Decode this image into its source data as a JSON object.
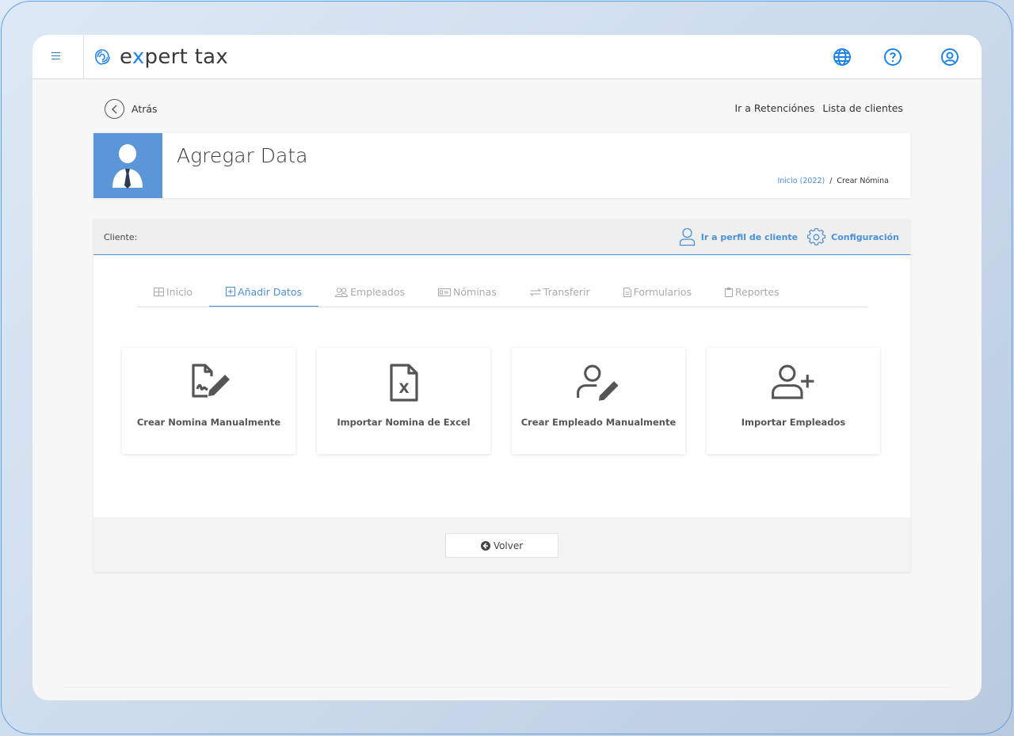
{
  "brand": {
    "name_prefix": "e",
    "name_x": "x",
    "name_suffix": "pert tax",
    "accent": "#1f84e6"
  },
  "topbar": {
    "icons": [
      "globe-icon",
      "help-icon",
      "user-circle-icon"
    ]
  },
  "nav": {
    "back_label": "Atrás",
    "links": [
      "Ir a Retenciónes",
      "Lista de clientes"
    ]
  },
  "header": {
    "title": "Agregar Data",
    "breadcrumb": {
      "home": "Inicio (2022)",
      "separator": "/",
      "current": "Crear Nómina"
    }
  },
  "panel": {
    "client_label": "Cliente:",
    "actions": {
      "profile": "Ir a perfil de cliente",
      "settings": "Configuración"
    },
    "tabs": [
      {
        "label": "Inicio",
        "icon": "grid-icon",
        "active": false
      },
      {
        "label": "Añadir Datos",
        "icon": "plus-square-icon",
        "active": true
      },
      {
        "label": "Empleados",
        "icon": "users-icon",
        "active": false
      },
      {
        "label": "Nóminas",
        "icon": "payroll-icon",
        "active": false
      },
      {
        "label": "Transferir",
        "icon": "transfer-icon",
        "active": false
      },
      {
        "label": "Formularios",
        "icon": "document-icon",
        "active": false
      },
      {
        "label": "Reportes",
        "icon": "clipboard-icon",
        "active": false
      }
    ],
    "cards": [
      {
        "label": "Crear Nomina Manualmente",
        "icon": "document-sign-icon"
      },
      {
        "label": "Importar Nomina de Excel",
        "icon": "excel-file-icon"
      },
      {
        "label": "Crear Empleado Manualmente",
        "icon": "user-edit-icon"
      },
      {
        "label": "Importar Empleados",
        "icon": "user-plus-icon"
      }
    ],
    "footer_button": "Volver"
  },
  "colors": {
    "link": "#4a90d9",
    "avatar_bg": "#5b96d8",
    "frame": "#5da3e2"
  }
}
